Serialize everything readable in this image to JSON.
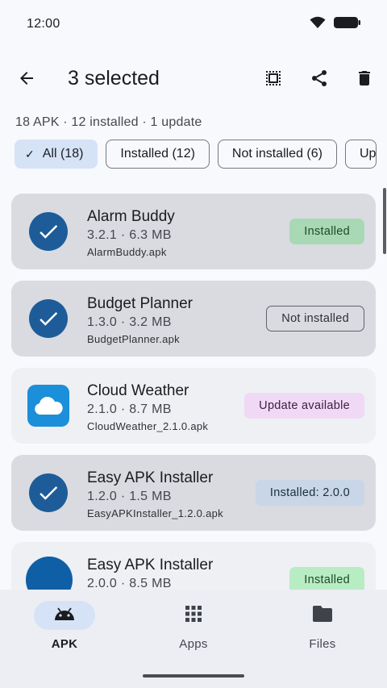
{
  "status_bar": {
    "time": "12:00"
  },
  "top_bar": {
    "title": "3 selected"
  },
  "summary": "18 APK · 12 installed · 1 update",
  "filters": [
    {
      "label": "All (18)",
      "selected": true
    },
    {
      "label": "Installed (12)",
      "selected": false
    },
    {
      "label": "Not installed (6)",
      "selected": false
    },
    {
      "label": "Up",
      "selected": false
    }
  ],
  "apps": [
    {
      "name": "Alarm Buddy",
      "meta": "3.2.1 · 6.3 MB",
      "file": "AlarmBuddy.apk",
      "badge": "Installed",
      "selected": true
    },
    {
      "name": "Budget Planner",
      "meta": "1.3.0 · 3.2 MB",
      "file": "BudgetPlanner.apk",
      "badge": "Not installed",
      "selected": true
    },
    {
      "name": "Cloud Weather",
      "meta": "2.1.0 · 8.7 MB",
      "file": "CloudWeather_2.1.0.apk",
      "badge": "Update available",
      "selected": false
    },
    {
      "name": "Easy APK Installer",
      "meta": "1.2.0 · 1.5 MB",
      "file": "EasyAPKInstaller_1.2.0.apk",
      "badge": "Installed: 2.0.0",
      "selected": true
    },
    {
      "name": "Easy APK Installer",
      "meta": "2.0.0 · 8.5 MB",
      "file": "",
      "badge": "Installed",
      "selected": false
    }
  ],
  "bottom_nav": [
    {
      "label": "APK",
      "icon": "android-icon",
      "active": true
    },
    {
      "label": "Apps",
      "icon": "grid-icon",
      "active": false
    },
    {
      "label": "Files",
      "icon": "folder-icon",
      "active": false
    }
  ],
  "colors": {
    "accent": "#1d5c99",
    "selected_card": "#d9dbe1",
    "chip_selected": "#d6e3f7",
    "installed_badge": "#a9d8b4",
    "update_badge": "#f0d9f5"
  }
}
